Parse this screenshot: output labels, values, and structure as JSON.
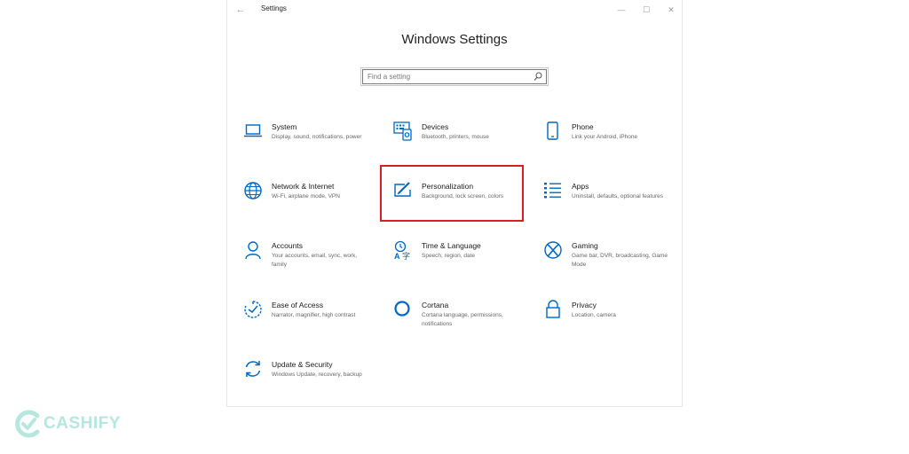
{
  "window": {
    "title": "Settings",
    "back_glyph": "←",
    "minimize_glyph": "—",
    "maximize_glyph": "☐",
    "close_glyph": "✕"
  },
  "heading": "Windows Settings",
  "search": {
    "placeholder": "Find a setting"
  },
  "accent_color": "#0067c0",
  "highlight_color": "#d72020",
  "tiles": [
    {
      "icon": "laptop-icon",
      "name": "System",
      "desc": "Display, sound, notifications, power"
    },
    {
      "icon": "keyboard-icon",
      "name": "Devices",
      "desc": "Bluetooth, printers, mouse"
    },
    {
      "icon": "phone-icon",
      "name": "Phone",
      "desc": "Link your Android, iPhone"
    },
    {
      "icon": "globe-icon",
      "name": "Network & Internet",
      "desc": "Wi-Fi, airplane mode, VPN"
    },
    {
      "icon": "pen-screen-icon",
      "name": "Personalization",
      "desc": "Background, lock screen, colors"
    },
    {
      "icon": "apps-list-icon",
      "name": "Apps",
      "desc": "Uninstall, defaults, optional features"
    },
    {
      "icon": "person-icon",
      "name": "Accounts",
      "desc": "Your accounts, email, sync, work, family"
    },
    {
      "icon": "time-language-icon",
      "name": "Time & Language",
      "desc": "Speech, region, date"
    },
    {
      "icon": "xbox-icon",
      "name": "Gaming",
      "desc": "Game bar, DVR, broadcasting, Game Mode"
    },
    {
      "icon": "ease-of-access-icon",
      "name": "Ease of Access",
      "desc": "Narrator, magnifier, high contrast"
    },
    {
      "icon": "cortana-circle-icon",
      "name": "Cortana",
      "desc": "Cortana language, permissions, notifications"
    },
    {
      "icon": "lock-icon",
      "name": "Privacy",
      "desc": "Location, camera"
    },
    {
      "icon": "update-sync-icon",
      "name": "Update & Security",
      "desc": "Windows Update, recovery, backup"
    }
  ],
  "watermark": {
    "text": "CASHIFY",
    "color": "#b5e7de"
  }
}
